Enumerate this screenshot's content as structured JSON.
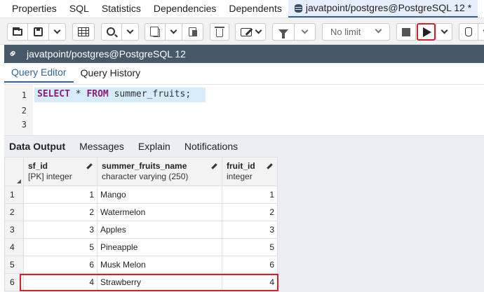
{
  "top_tabs": [
    "Properties",
    "SQL",
    "Statistics",
    "Dependencies",
    "Dependents"
  ],
  "active_tab": "javatpoint/postgres@PostgreSQL 12 *",
  "toolbar": {
    "limit_label": "No limit",
    "icons": [
      "folder-open-icon",
      "save-icon",
      "grid-icon",
      "search-icon",
      "copy-icon",
      "paste-icon",
      "trash-icon",
      "edit-icon",
      "filter-icon",
      "stop-icon",
      "play-icon",
      "hand-icon"
    ]
  },
  "connection": {
    "label": "javatpoint/postgres@PostgreSQL 12"
  },
  "editor_tabs": [
    "Query Editor",
    "Query History"
  ],
  "editor": {
    "line_numbers": [
      "1",
      "2",
      "3"
    ],
    "keyword_select": "SELECT",
    "star": "*",
    "keyword_from": "FROM",
    "table": "summer_fruits;"
  },
  "result_tabs": [
    "Data Output",
    "Messages",
    "Explain",
    "Notifications"
  ],
  "grid": {
    "columns": [
      {
        "name": "sf_id",
        "type": "[PK] integer"
      },
      {
        "name": "summer_fruits_name",
        "type": "character varying (250)"
      },
      {
        "name": "fruit_id",
        "type": "integer"
      }
    ],
    "rows": [
      {
        "n": "1",
        "sf_id": "1",
        "name": "Mango",
        "fruit_id": "1"
      },
      {
        "n": "2",
        "sf_id": "2",
        "name": "Watermelon",
        "fruit_id": "2"
      },
      {
        "n": "3",
        "sf_id": "3",
        "name": "Apples",
        "fruit_id": "3"
      },
      {
        "n": "4",
        "sf_id": "5",
        "name": "Pineapple",
        "fruit_id": "5"
      },
      {
        "n": "5",
        "sf_id": "6",
        "name": "Musk Melon",
        "fruit_id": "6"
      },
      {
        "n": "6",
        "sf_id": "4",
        "name": "Strawberry",
        "fruit_id": "4"
      }
    ]
  }
}
